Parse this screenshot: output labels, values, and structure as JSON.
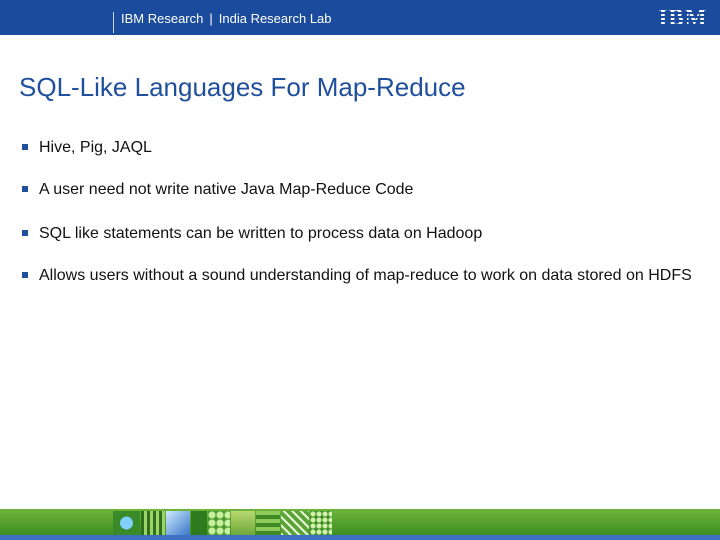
{
  "header": {
    "org": "IBM Research",
    "separator": "|",
    "lab": "India Research Lab",
    "logo_text": "IBM"
  },
  "title": "SQL-Like Languages For Map-Reduce",
  "bullets": [
    "Hive, Pig, JAQL",
    "A user need not write native Java Map-Reduce Code",
    "SQL like statements can be written to process data on Hadoop",
    "Allows users without a sound understanding of map-reduce to work on data stored on HDFS"
  ],
  "colors": {
    "header_bg": "#1a4b9c",
    "title": "#1f4f9d",
    "bullet_marker": "#1f4f9d",
    "footer_green": "#4f9e2a",
    "footer_blue": "#3e6fc2"
  }
}
